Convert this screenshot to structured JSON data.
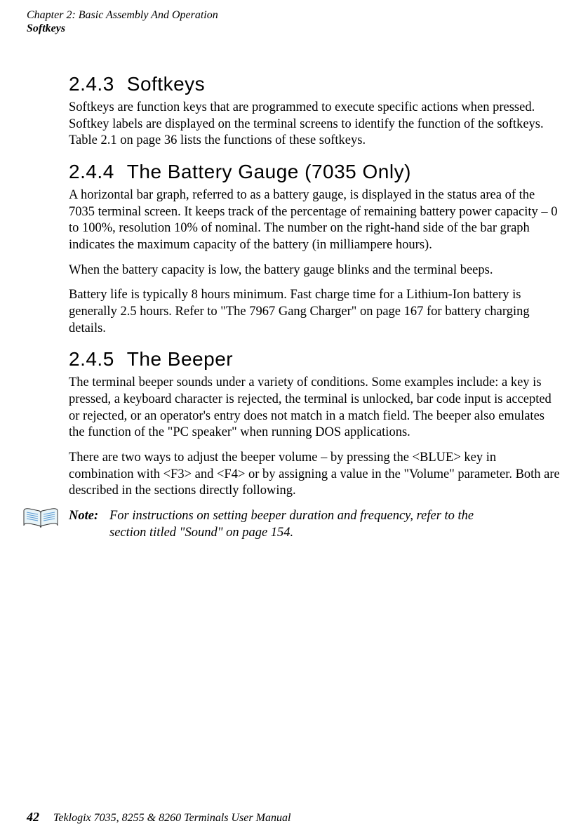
{
  "header": {
    "chapter": "Chapter 2: Basic Assembly And Operation",
    "topic": "Softkeys"
  },
  "sections": {
    "s243": {
      "number": "2.4.3",
      "title": "Softkeys",
      "p1": "Softkeys are function keys that are programmed to execute specific actions when pressed. Softkey labels are displayed on the terminal screens to identify the function of the softkeys. Table 2.1 on page 36 lists the functions of these softkeys."
    },
    "s244": {
      "number": "2.4.4",
      "title": "The Battery Gauge (7035 Only)",
      "p1": "A horizontal bar graph, referred to as a battery gauge, is displayed in the status area of the 7035 terminal screen. It keeps track of the percentage of remaining battery power capacity – 0 to 100%, resolution 10% of nominal. The number on the right-hand side of the bar graph indicates the maximum capacity of the battery (in milliampere hours).",
      "p2": "When the battery capacity is low, the battery gauge blinks and the terminal beeps.",
      "p3": "Battery life is typically 8 hours minimum. Fast charge time for a Lithium-Ion battery is generally 2.5 hours. Refer to \"The 7967 Gang Charger\" on page 167 for battery charging details."
    },
    "s245": {
      "number": "2.4.5",
      "title": "The Beeper",
      "p1": "The terminal beeper sounds under a variety of conditions. Some examples include: a key is pressed, a keyboard character is rejected, the terminal is unlocked, bar code input is accepted or rejected, or an operator's entry does not match in a match field. The beeper also emulates the function of the \"PC speaker\" when running DOS applications.",
      "p2": "There are two ways to adjust the beeper volume – by pressing the <BLUE> key in combination with <F3> and <F4> or by assigning a value in the \"Volume\" parameter. Both are described in the sections directly following."
    }
  },
  "note": {
    "label": "Note:",
    "body_line1": "For instructions on setting beeper duration and frequency, refer to the",
    "body_line2": "section titled \"Sound\" on page 154."
  },
  "footer": {
    "page_number": "42",
    "manual_title": "Teklogix 7035, 8255 & 8260 Terminals User Manual"
  }
}
